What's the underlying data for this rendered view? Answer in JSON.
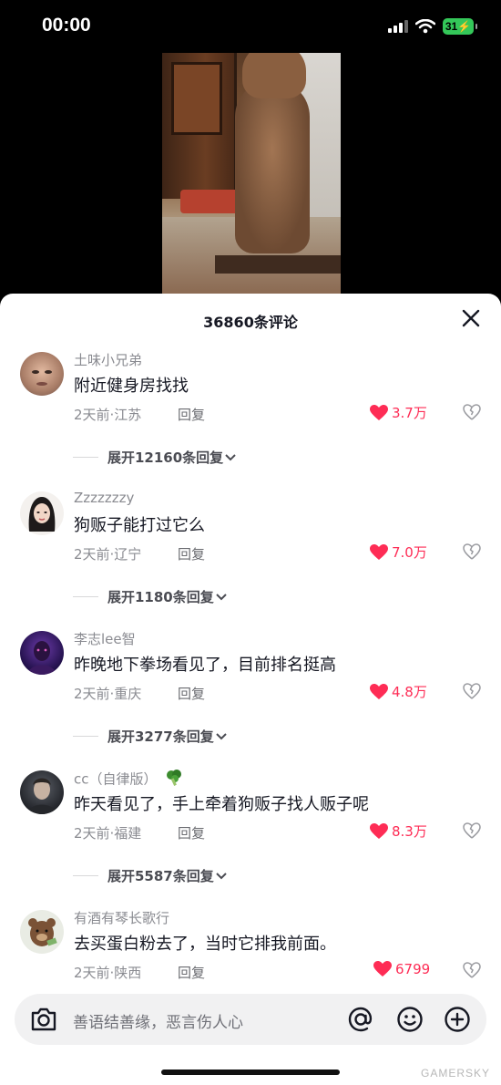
{
  "status_bar": {
    "time": "00:00",
    "battery": "31"
  },
  "sheet": {
    "title": "36860条评论"
  },
  "comments": [
    {
      "user": "土味小兄弟",
      "text": "附近健身房找找",
      "meta": "2天前·江苏",
      "reply": "回复",
      "likes": "3.7万",
      "expand": "展开12160条回复"
    },
    {
      "user": "Zzzzzzzy",
      "text": "狗贩子能打过它么",
      "meta": "2天前·辽宁",
      "reply": "回复",
      "likes": "7.0万",
      "expand": "展开1180条回复"
    },
    {
      "user": "李志lee智",
      "text": "昨晚地下拳场看见了，目前排名挺高",
      "meta": "2天前·重庆",
      "reply": "回复",
      "likes": "4.8万",
      "expand": "展开3277条回复"
    },
    {
      "user": "cc（自律版）",
      "text": "昨天看见了，手上牵着狗贩子找人贩子呢",
      "meta": "2天前·福建",
      "reply": "回复",
      "likes": "8.3万",
      "expand": "展开5587条回复"
    },
    {
      "user": "有酒有琴长歌行",
      "text": "去买蛋白粉去了，当时它排我前面。",
      "meta": "2天前·陕西",
      "reply": "回复",
      "likes": "6799"
    }
  ],
  "input": {
    "placeholder": "善语结善缘，恶言伤人心"
  },
  "watermark": "GAMERSKY",
  "colors": {
    "like": "#fe2c55",
    "text": "#161823",
    "secondary": "#8a8b91"
  }
}
